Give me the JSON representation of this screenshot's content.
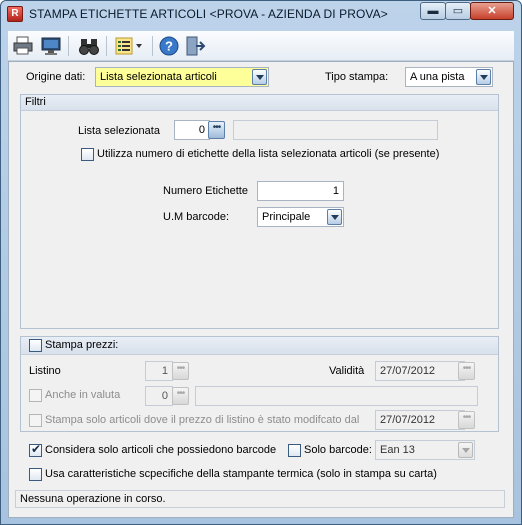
{
  "window": {
    "title": "STAMPA ETICHETTE ARTICOLI <PROVA - AZIENDA DI PROVA>",
    "controls": {
      "minimize": "▬",
      "maximize": "▭",
      "close": "✕"
    }
  },
  "toolbar": {
    "buttons": [
      "printer-icon",
      "monitor-icon",
      "binoculars-icon",
      "list-options-icon",
      "help-icon",
      "exit-icon"
    ]
  },
  "header": {
    "origine_label": "Origine dati:",
    "origine_value": "Lista selezionata articoli",
    "tipo_label": "Tipo stampa:",
    "tipo_value": "A una pista"
  },
  "filtri": {
    "title": "Filtri",
    "lista_label": "Lista selezionata",
    "lista_value": "0",
    "lista_desc": "",
    "utilizza_label": "Utilizza numero di etichette della lista selezionata articoli (se presente)",
    "utilizza_checked": false,
    "numero_label": "Numero Etichette",
    "numero_value": "1",
    "um_label": "U.M barcode:",
    "um_value": "Principale"
  },
  "prezzi": {
    "title": "Stampa prezzi:",
    "checked": false,
    "listino_label": "Listino",
    "listino_value": "1",
    "validita_label": "Validità",
    "validita_value": "27/07/2012",
    "valuta_label": "Anche in valuta",
    "valuta_value": "0",
    "valuta_desc": "",
    "solo_mod_label": "Stampa solo articoli dove il prezzo di listino è stato modifcato dal",
    "solo_mod_value": "27/07/2012"
  },
  "options": {
    "considera_label": "Considera solo articoli che possiedono barcode",
    "considera_checked": true,
    "solo_barcode_label": "Solo barcode:",
    "solo_barcode_checked": false,
    "barcode_type": "Ean 13",
    "termica_label": "Usa caratteristiche scpecifiche della stampante termica (solo in stampa su carta)",
    "termica_checked": false
  },
  "status": {
    "text": "Nessuna operazione in corso."
  },
  "colors": {
    "titlebar": "#bcd3ea",
    "accent": "#3b5b7e",
    "selection": "#ffff99"
  }
}
